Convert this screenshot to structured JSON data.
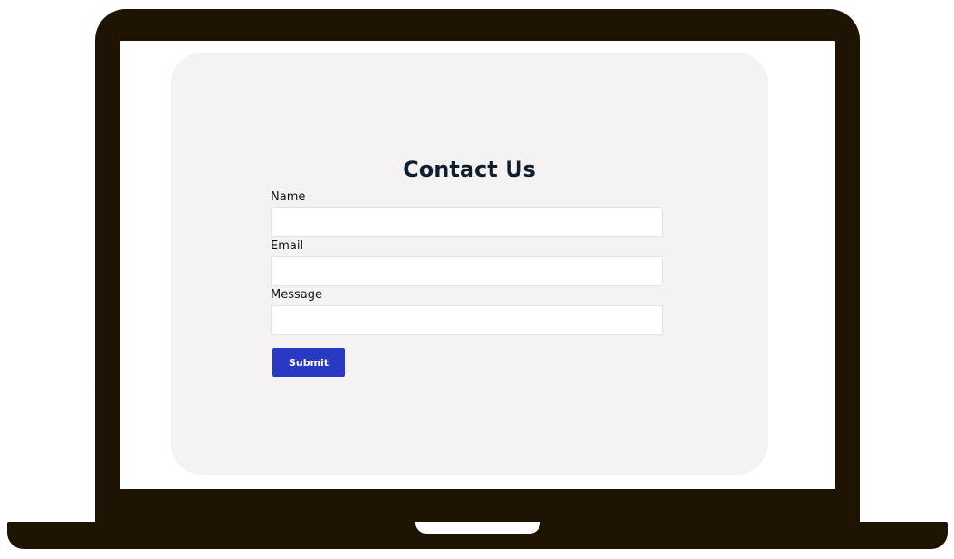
{
  "contact_form": {
    "title": "Contact Us",
    "fields": {
      "name": {
        "label": "Name",
        "value": "",
        "placeholder": ""
      },
      "email": {
        "label": "Email",
        "value": "",
        "placeholder": ""
      },
      "message": {
        "label": "Message",
        "value": "",
        "placeholder": ""
      }
    },
    "submit_label": "Submit"
  },
  "colors": {
    "device_frame": "#1f1304",
    "card_background": "#f4f2f3",
    "submit_button": "#2939c4",
    "heading_text": "#10202a"
  }
}
